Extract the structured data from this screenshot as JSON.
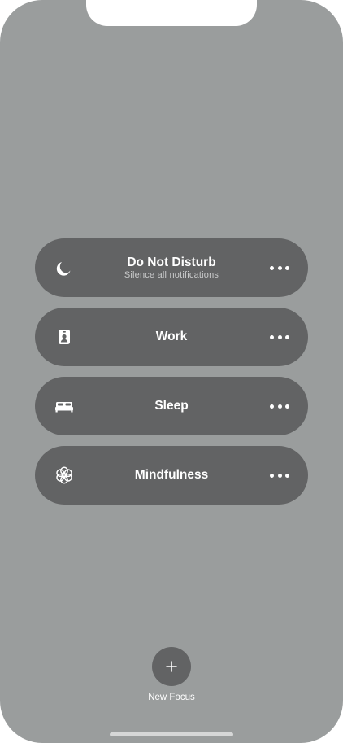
{
  "focus_modes": [
    {
      "title": "Do Not Disturb",
      "subtitle": "Silence all notifications",
      "icon": "moon-icon",
      "more_icon": "ellipsis-icon"
    },
    {
      "title": "Work",
      "subtitle": "",
      "icon": "id-badge-icon",
      "more_icon": "ellipsis-icon"
    },
    {
      "title": "Sleep",
      "subtitle": "",
      "icon": "bed-icon",
      "more_icon": "ellipsis-icon"
    },
    {
      "title": "Mindfulness",
      "subtitle": "",
      "icon": "flower-icon",
      "more_icon": "ellipsis-icon"
    }
  ],
  "new_focus": {
    "label": "New Focus",
    "icon": "plus-icon"
  },
  "colors": {
    "background": "#9a9d9d",
    "tile": "#626364",
    "text": "#ffffff",
    "subtext": "#c9cacb"
  }
}
